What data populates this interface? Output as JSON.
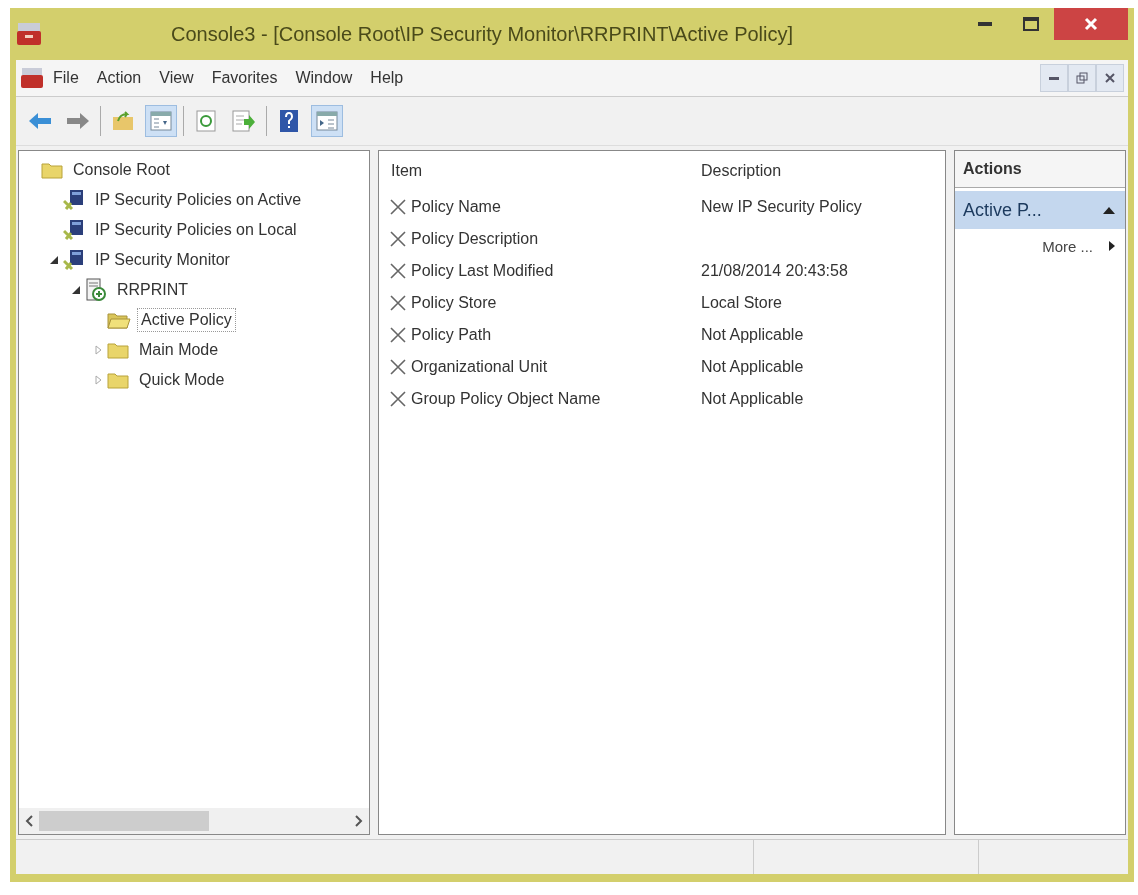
{
  "window": {
    "title": "Console3 - [Console Root\\IP Security Monitor\\RRPRINT\\Active Policy]",
    "controls": [
      {
        "kind": "minimize"
      },
      {
        "kind": "maximize"
      },
      {
        "kind": "close"
      }
    ]
  },
  "menu": [
    "File",
    "Action",
    "View",
    "Favorites",
    "Window",
    "Help"
  ],
  "child_controls": [
    {
      "kind": "minimize"
    },
    {
      "kind": "restore"
    },
    {
      "kind": "close"
    }
  ],
  "toolbar": [
    {
      "kind": "back",
      "pressed": false
    },
    {
      "kind": "forward",
      "pressed": false
    },
    {
      "kind": "sep"
    },
    {
      "kind": "up",
      "pressed": false
    },
    {
      "kind": "tree",
      "pressed": true
    },
    {
      "kind": "sep"
    },
    {
      "kind": "refresh",
      "pressed": false
    },
    {
      "kind": "export",
      "pressed": false
    },
    {
      "kind": "sep"
    },
    {
      "kind": "help",
      "pressed": false
    },
    {
      "kind": "actionpane",
      "pressed": true
    }
  ],
  "tree": [
    {
      "label": "Console Root",
      "kind": "folder",
      "selected": false,
      "children": [
        {
          "label": "IP Security Policies on Active",
          "kind": "computer",
          "selected": false
        },
        {
          "label": "IP Security Policies on Local",
          "kind": "computer",
          "selected": false
        },
        {
          "label": "IP Security Monitor",
          "kind": "computer",
          "selected": false,
          "expanded": true,
          "children": [
            {
              "label": "RRPRINT",
              "kind": "server",
              "selected": false,
              "expanded": true,
              "children": [
                {
                  "label": "Active Policy",
                  "kind": "openfolder",
                  "selected": true
                },
                {
                  "label": "Main Mode",
                  "kind": "folder",
                  "selected": false,
                  "expanded": false
                },
                {
                  "label": "Quick Mode",
                  "kind": "folder",
                  "selected": false,
                  "expanded": false
                }
              ]
            }
          ]
        }
      ]
    }
  ],
  "table": {
    "columns": [
      "Item",
      "Description"
    ],
    "rows": [
      [
        "Policy Name",
        "New IP Security Policy"
      ],
      [
        "Policy Description",
        ""
      ],
      [
        "Policy Last Modified",
        "21/08/2014 20:43:58"
      ],
      [
        "Policy Store",
        "Local Store"
      ],
      [
        "Policy Path",
        "Not Applicable"
      ],
      [
        "Organizational Unit",
        "Not Applicable"
      ],
      [
        "Group Policy Object Name",
        "Not Applicable"
      ]
    ]
  },
  "actions": {
    "title": "Actions",
    "group": {
      "label": "Active P...",
      "expanded": true
    },
    "items": [
      "More ..."
    ]
  }
}
